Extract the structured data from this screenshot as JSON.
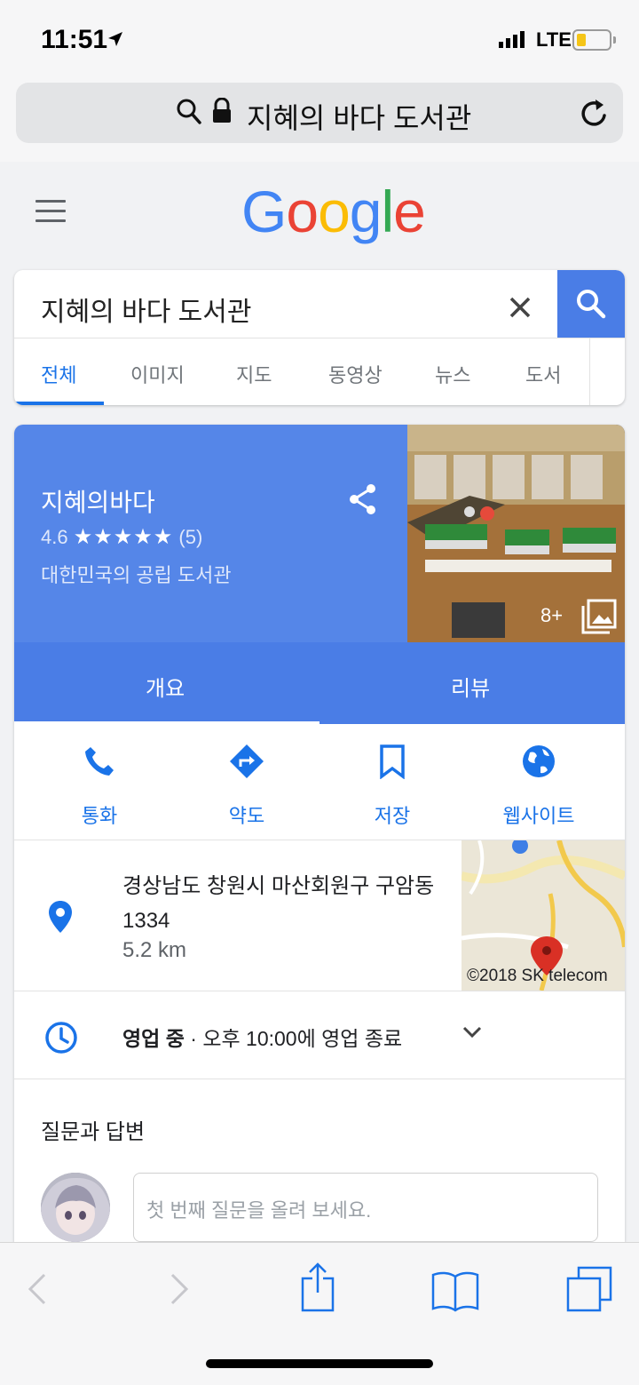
{
  "status_bar": {
    "time": "11:51",
    "network": "LTE"
  },
  "url_bar": {
    "text": "지혜의 바다 도서관"
  },
  "google": {
    "logo_letters": [
      "G",
      "o",
      "o",
      "g",
      "l",
      "e"
    ],
    "logo_colors": [
      "#4285F4",
      "#EA4335",
      "#FBBC05",
      "#4285F4",
      "#34A853",
      "#EA4335"
    ]
  },
  "search": {
    "query": "지혜의 바다 도서관",
    "tabs": [
      {
        "label": "전체",
        "active": true
      },
      {
        "label": "이미지"
      },
      {
        "label": "지도"
      },
      {
        "label": "동영상"
      },
      {
        "label": "뉴스"
      },
      {
        "label": "도서"
      }
    ]
  },
  "place": {
    "name": "지혜의바다",
    "rating": "4.6",
    "stars": "★★★★★",
    "review_count": "(5)",
    "type": "대한민국의 공립 도서관",
    "photo_count": "8+",
    "tabs": [
      {
        "label": "개요",
        "active": true
      },
      {
        "label": "리뷰"
      }
    ],
    "actions": [
      {
        "label": "통화",
        "icon": "phone-icon"
      },
      {
        "label": "약도",
        "icon": "directions-icon"
      },
      {
        "label": "저장",
        "icon": "bookmark-icon"
      },
      {
        "label": "웹사이트",
        "icon": "globe-icon"
      }
    ],
    "address": "경상남도 창원시 마산회원구 구암동 1334",
    "distance": "5.2 km",
    "map_credit": "©2018 SK telecom",
    "hours_status": "영업 중",
    "hours_detail": " · 오후 10:00에 영업 종료",
    "qa_title": "질문과 답변",
    "qa_placeholder": "첫 번째 질문을 올려 보세요."
  },
  "colors": {
    "accent_blue": "#1a73e8",
    "card_blue": "#5586e8",
    "tab_blue": "#4a7de6"
  }
}
